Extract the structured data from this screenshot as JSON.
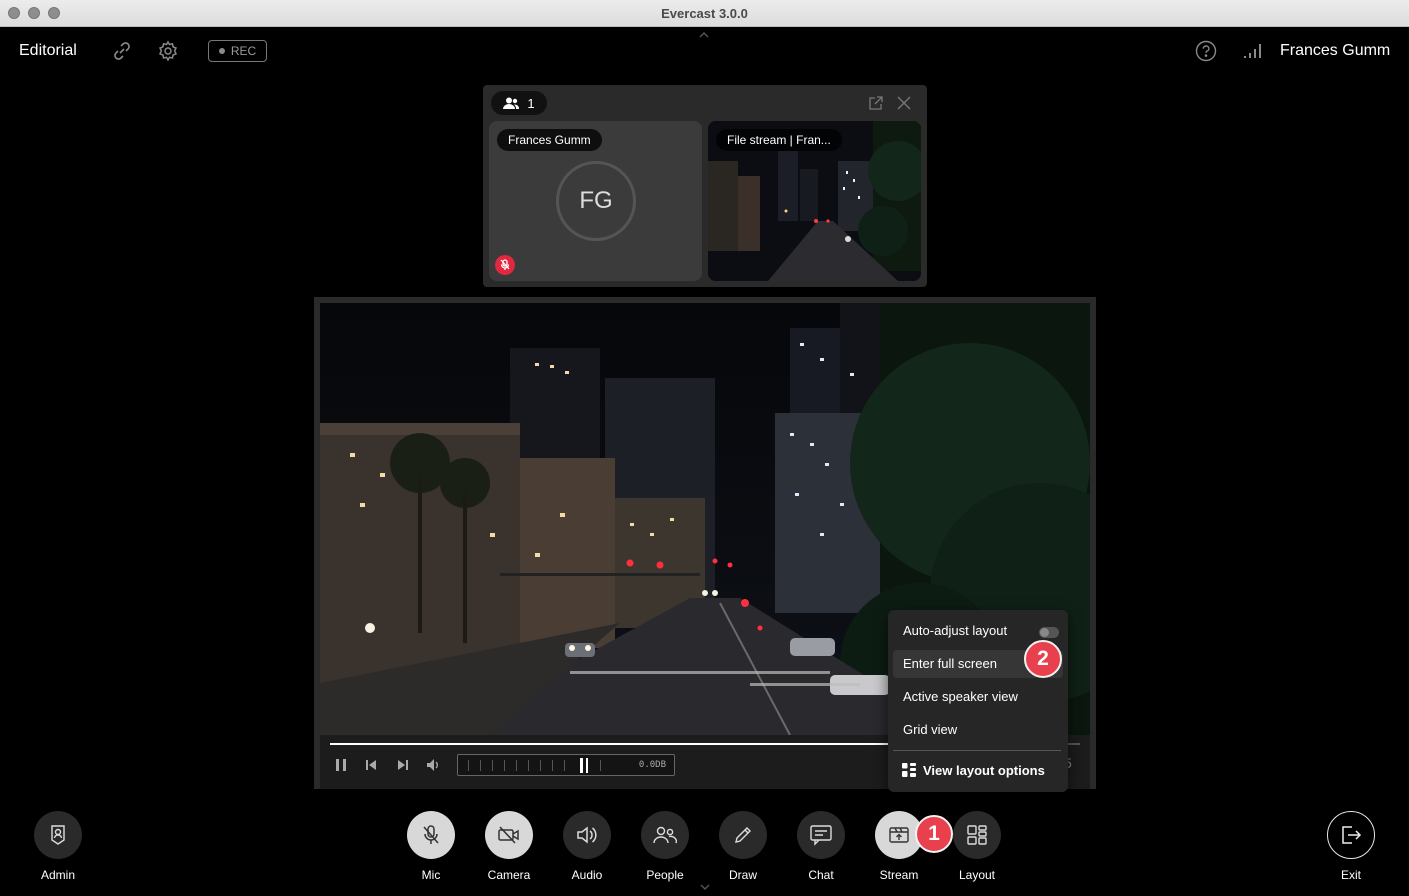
{
  "window": {
    "title": "Evercast 3.0.0"
  },
  "header": {
    "room_name": "Editorial",
    "rec_label": "REC",
    "user_name": "Frances Gumm",
    "icons": [
      "link-icon",
      "gear-icon",
      "help-icon",
      "signal-icon"
    ]
  },
  "participants": {
    "count": "1",
    "tiles": [
      {
        "label": "Frances Gumm",
        "initials": "FG",
        "muted": true
      },
      {
        "label": "File stream | Fran..."
      }
    ]
  },
  "player": {
    "meter_db": "0.0DB",
    "counter_text": "5"
  },
  "layout_menu": {
    "items": [
      {
        "label": "Auto-adjust layout",
        "toggle": false
      },
      {
        "label": "Enter full screen",
        "highlighted": true
      },
      {
        "label": "Active speaker view"
      },
      {
        "label": "Grid view"
      }
    ],
    "footer": "View layout options"
  },
  "steps": {
    "one": "1",
    "two": "2"
  },
  "toolbar": {
    "admin": "Admin",
    "mic": "Mic",
    "camera": "Camera",
    "audio": "Audio",
    "people": "People",
    "draw": "Draw",
    "chat": "Chat",
    "stream": "Stream",
    "layout": "Layout",
    "exit": "Exit"
  },
  "colors": {
    "accent_red": "#e8414d",
    "muted_red": "#e0283f",
    "panel": "#2a2a2a"
  }
}
